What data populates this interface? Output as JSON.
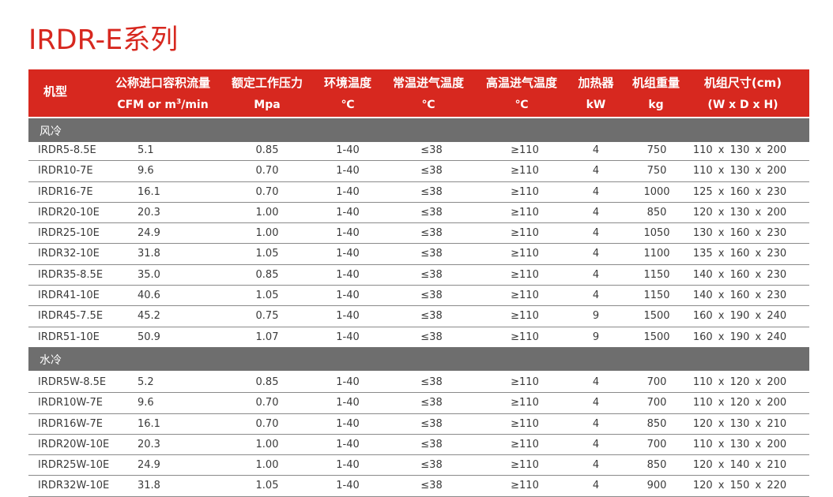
{
  "title": "IRDR-E系列",
  "header": {
    "model": "机型",
    "flow_line1": "公称进口容积流量",
    "flow_line2_prefix": "CFM or m",
    "flow_line2_sup": "3",
    "flow_line2_suffix": "/min",
    "pressure_line1": "额定工作压力",
    "pressure_line2": "Mpa",
    "ambient_line1": "环境温度",
    "ambient_line2": "℃",
    "inlet_normal_line1": "常温进气温度",
    "inlet_normal_line2": "℃",
    "inlet_high_line1": "高温进气温度",
    "inlet_high_line2": "℃",
    "heater_line1": "加热器",
    "heater_line2": "kW",
    "weight_line1": "机组重量",
    "weight_line2": "kg",
    "size_line1": "机组尺寸(cm)",
    "size_line2": "(W x D x H)"
  },
  "sections": [
    {
      "label": "风冷",
      "rows": [
        {
          "model": "IRDR5-8.5E",
          "flow": "5.1",
          "pressure": "0.85",
          "ambient": "1-40",
          "inlet_normal": "≤38",
          "inlet_high": "≥110",
          "heater": "4",
          "weight": "750",
          "size": "110 x 130 x 200"
        },
        {
          "model": "IRDR10-7E",
          "flow": "9.6",
          "pressure": "0.70",
          "ambient": "1-40",
          "inlet_normal": "≤38",
          "inlet_high": "≥110",
          "heater": "4",
          "weight": "750",
          "size": "110 x 130 x 200"
        },
        {
          "model": "IRDR16-7E",
          "flow": "16.1",
          "pressure": "0.70",
          "ambient": "1-40",
          "inlet_normal": "≤38",
          "inlet_high": "≥110",
          "heater": "4",
          "weight": "1000",
          "size": "125 x 160 x 230"
        },
        {
          "model": "IRDR20-10E",
          "flow": "20.3",
          "pressure": "1.00",
          "ambient": "1-40",
          "inlet_normal": "≤38",
          "inlet_high": "≥110",
          "heater": "4",
          "weight": "850",
          "size": "120 x 130 x 200"
        },
        {
          "model": "IRDR25-10E",
          "flow": "24.9",
          "pressure": "1.00",
          "ambient": "1-40",
          "inlet_normal": "≤38",
          "inlet_high": "≥110",
          "heater": "4",
          "weight": "1050",
          "size": "130 x 160 x 230"
        },
        {
          "model": "IRDR32-10E",
          "flow": "31.8",
          "pressure": "1.05",
          "ambient": "1-40",
          "inlet_normal": "≤38",
          "inlet_high": "≥110",
          "heater": "4",
          "weight": "1100",
          "size": "135 x 160 x 230"
        },
        {
          "model": "IRDR35-8.5E",
          "flow": "35.0",
          "pressure": "0.85",
          "ambient": "1-40",
          "inlet_normal": "≤38",
          "inlet_high": "≥110",
          "heater": "4",
          "weight": "1150",
          "size": "140 x 160 x 230"
        },
        {
          "model": "IRDR41-10E",
          "flow": "40.6",
          "pressure": "1.05",
          "ambient": "1-40",
          "inlet_normal": "≤38",
          "inlet_high": "≥110",
          "heater": "4",
          "weight": "1150",
          "size": "140 x 160 x 230"
        },
        {
          "model": "IRDR45-7.5E",
          "flow": "45.2",
          "pressure": "0.75",
          "ambient": "1-40",
          "inlet_normal": "≤38",
          "inlet_high": "≥110",
          "heater": "9",
          "weight": "1500",
          "size": "160 x 190 x 240"
        },
        {
          "model": "IRDR51-10E",
          "flow": "50.9",
          "pressure": "1.07",
          "ambient": "1-40",
          "inlet_normal": "≤38",
          "inlet_high": "≥110",
          "heater": "9",
          "weight": "1500",
          "size": "160 x 190 x 240"
        }
      ]
    },
    {
      "label": "水冷",
      "rows": [
        {
          "model": "IRDR5W-8.5E",
          "flow": "5.2",
          "pressure": "0.85",
          "ambient": "1-40",
          "inlet_normal": "≤38",
          "inlet_high": "≥110",
          "heater": "4",
          "weight": "700",
          "size": "110 x 120 x 200"
        },
        {
          "model": "IRDR10W-7E",
          "flow": "9.6",
          "pressure": "0.70",
          "ambient": "1-40",
          "inlet_normal": "≤38",
          "inlet_high": "≥110",
          "heater": "4",
          "weight": "700",
          "size": "110 x 120 x 200"
        },
        {
          "model": "IRDR16W-7E",
          "flow": "16.1",
          "pressure": "0.70",
          "ambient": "1-40",
          "inlet_normal": "≤38",
          "inlet_high": "≥110",
          "heater": "4",
          "weight": "850",
          "size": "120 x 130 x 210"
        },
        {
          "model": "IRDR20W-10E",
          "flow": "20.3",
          "pressure": "1.00",
          "ambient": "1-40",
          "inlet_normal": "≤38",
          "inlet_high": "≥110",
          "heater": "4",
          "weight": "700",
          "size": "110 x 130 x 200"
        },
        {
          "model": "IRDR25W-10E",
          "flow": "24.9",
          "pressure": "1.00",
          "ambient": "1-40",
          "inlet_normal": "≤38",
          "inlet_high": "≥110",
          "heater": "4",
          "weight": "850",
          "size": "120 x 140 x 210"
        },
        {
          "model": "IRDR32W-10E",
          "flow": "31.8",
          "pressure": "1.05",
          "ambient": "1-40",
          "inlet_normal": "≤38",
          "inlet_high": "≥110",
          "heater": "4",
          "weight": "900",
          "size": "120 x 150 x 220"
        }
      ]
    }
  ],
  "colors": {
    "accent": "#d7281f",
    "section_bar": "#6e6e6e"
  }
}
